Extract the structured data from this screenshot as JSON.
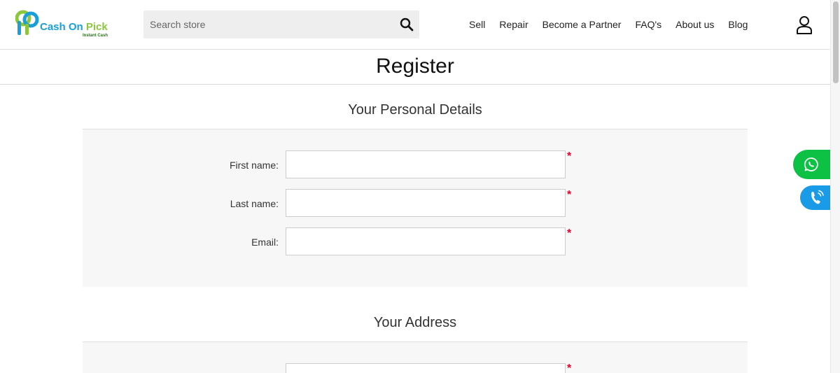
{
  "header": {
    "logo": {
      "name": "Cash On Pick",
      "name_part1": "Cash On",
      "name_part2": "Pick",
      "tagline": "Instant Cash"
    },
    "search": {
      "placeholder": "Search store",
      "value": ""
    },
    "nav": [
      {
        "label": "Sell"
      },
      {
        "label": "Repair"
      },
      {
        "label": "Become a Partner"
      },
      {
        "label": "FAQ's"
      },
      {
        "label": "About us"
      },
      {
        "label": "Blog"
      }
    ],
    "user_icon": "user-icon"
  },
  "page": {
    "title": "Register"
  },
  "personal_details": {
    "title": "Your Personal Details",
    "fields": [
      {
        "label": "First name:",
        "value": "",
        "required_mark": "*"
      },
      {
        "label": "Last name:",
        "value": "",
        "required_mark": "*"
      },
      {
        "label": "Email:",
        "value": "",
        "required_mark": "*"
      }
    ]
  },
  "address": {
    "title": "Your Address",
    "fields": [
      {
        "label": "",
        "value": "",
        "required_mark": "*"
      }
    ]
  },
  "floating": {
    "whatsapp_icon": "whatsapp-icon",
    "call_icon": "phone-call-icon"
  },
  "colors": {
    "brand_blue": "#1a9fd9",
    "brand_green": "#8cc63f",
    "required": "#e4002b",
    "whatsapp": "#0cc143",
    "call": "#1a9be8"
  }
}
